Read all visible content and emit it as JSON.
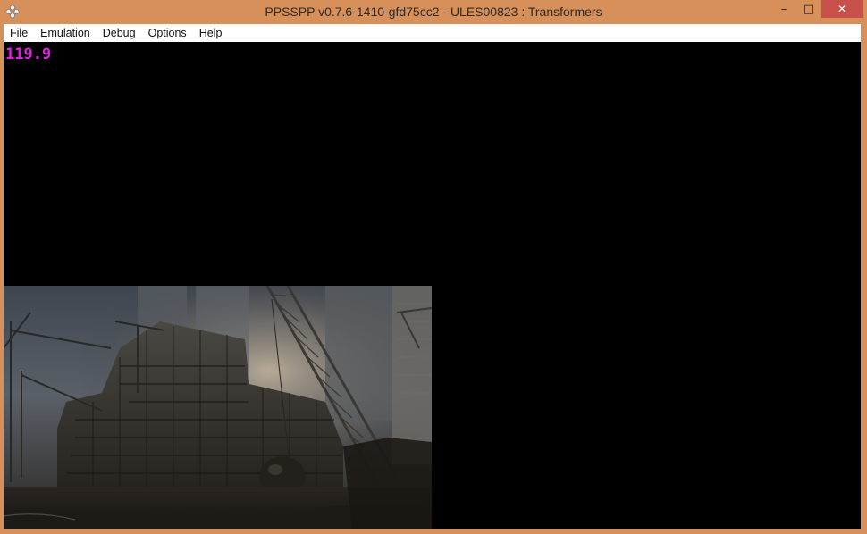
{
  "window": {
    "title": "PPSSPP v0.7.6-1410-gfd75cc2 - ULES00823 : Transformers",
    "app_icon": "psp-gamepad-icon",
    "controls": {
      "minimize": "–",
      "maximize": "□",
      "close": "✕"
    }
  },
  "menu": {
    "items": [
      "File",
      "Emulation",
      "Debug",
      "Options",
      "Help"
    ]
  },
  "overlay": {
    "fps": "119.9"
  },
  "colors": {
    "frame": "#d8905a",
    "close_button": "#c7504a",
    "fps_text": "#e41ee4",
    "viewport": "#000000"
  }
}
